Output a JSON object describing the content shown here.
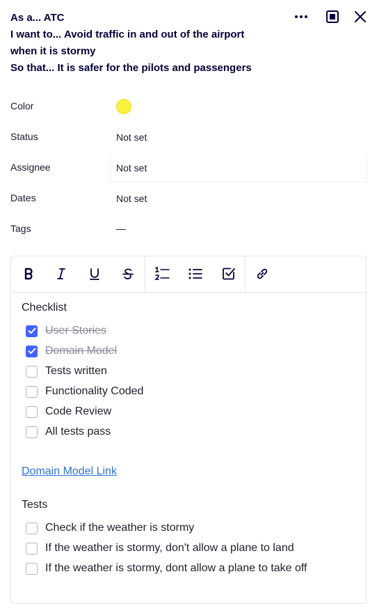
{
  "card": {
    "title_lines": [
      "As a... ATC",
      "I want to... Avoid traffic in and out of the airport",
      "when it is stormy",
      "So that... It is safer for the pilots and passengers"
    ]
  },
  "header_icons": [
    "more-icon",
    "expand-icon",
    "close-icon"
  ],
  "properties": {
    "color": {
      "label": "Color",
      "value_color": "#f9f13b"
    },
    "status": {
      "label": "Status",
      "value": "Not set"
    },
    "assignee": {
      "label": "Assignee",
      "value": "Not set"
    },
    "dates": {
      "label": "Dates",
      "value": "Not set"
    },
    "tags": {
      "label": "Tags",
      "value": "—"
    }
  },
  "toolbar": [
    "bold-icon",
    "italic-icon",
    "underline-icon",
    "strikethrough-icon",
    "ordered-list-icon",
    "bullet-list-icon",
    "checklist-icon",
    "link-icon"
  ],
  "checklist": {
    "title": "Checklist",
    "items": [
      {
        "label": "User Stories",
        "checked": true
      },
      {
        "label": "Domain Model",
        "checked": true
      },
      {
        "label": "Tests written",
        "checked": false
      },
      {
        "label": "Functionality Coded",
        "checked": false
      },
      {
        "label": "Code Review",
        "checked": false
      },
      {
        "label": "All tests pass",
        "checked": false
      }
    ]
  },
  "link": {
    "text": "Domain Model Link"
  },
  "tests": {
    "title": "Tests",
    "items": [
      {
        "label": "Check if the weather is stormy",
        "checked": false
      },
      {
        "label": "If the weather is stormy, don't allow a plane to land",
        "checked": false
      },
      {
        "label": "If the weather is stormy, dont allow a plane to take off",
        "checked": false
      }
    ]
  },
  "colors": {
    "accent": "#4262ff",
    "link": "#2f74d6",
    "text": "#050038"
  }
}
